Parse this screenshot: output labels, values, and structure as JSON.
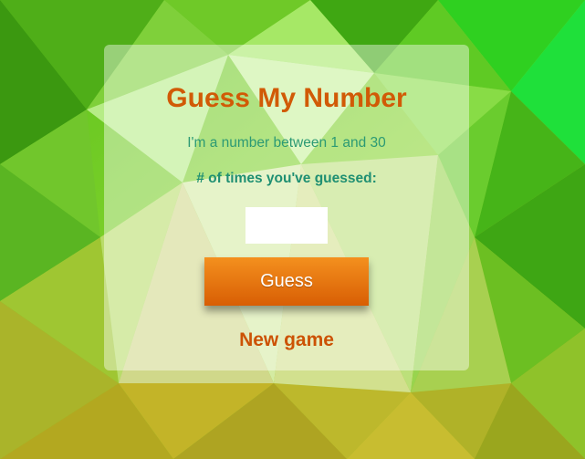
{
  "colors": {
    "title": "#d15a06",
    "subtitle": "#2c9a74",
    "count_label": "#1f8f72",
    "button_top": "#f4901e",
    "button_bottom": "#d85e04",
    "new_game": "#cc5204",
    "background_light": "#9fe35a",
    "background_dark": "#2f8e14"
  },
  "game": {
    "title": "Guess My Number",
    "subtitle": "I'm a number between 1 and 30",
    "count_label": "# of times you've guessed:",
    "guess_input_value": "",
    "guess_button_label": "Guess",
    "new_game_label": "New game"
  }
}
